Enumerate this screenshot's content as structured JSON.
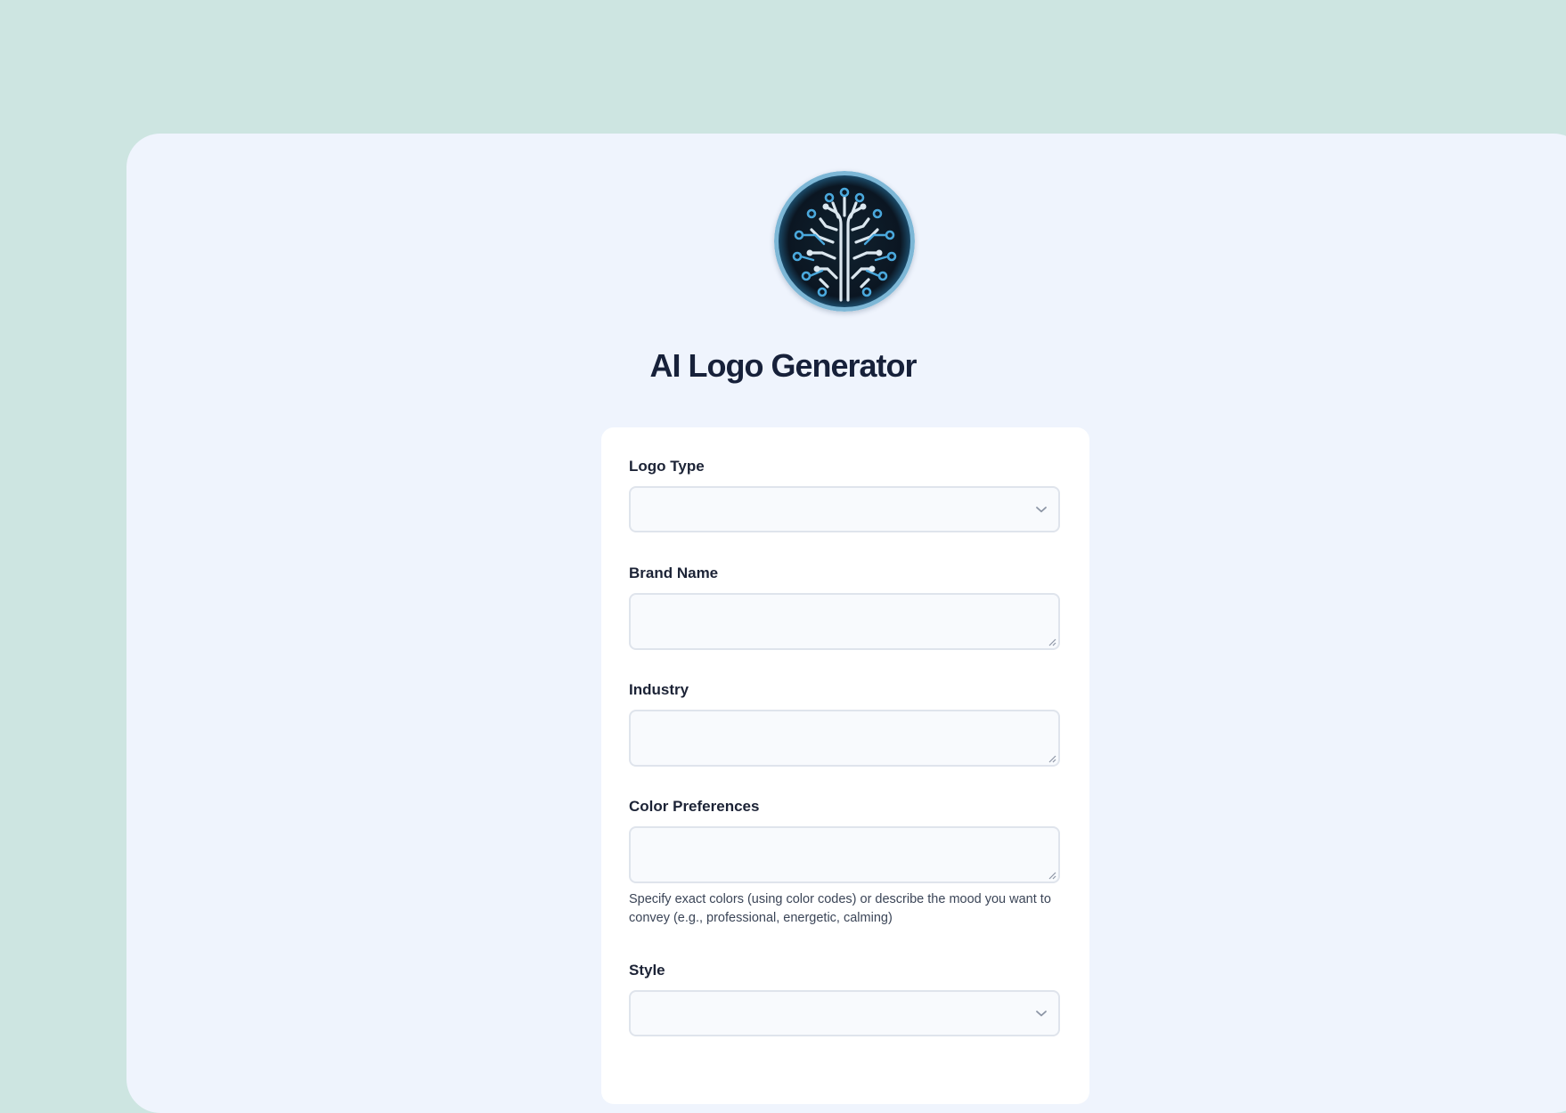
{
  "app": {
    "title": "AI Logo Generator"
  },
  "form": {
    "logo_type": {
      "label": "Logo Type",
      "value": ""
    },
    "brand_name": {
      "label": "Brand Name",
      "value": ""
    },
    "industry": {
      "label": "Industry",
      "value": ""
    },
    "color_preferences": {
      "label": "Color Preferences",
      "value": "",
      "help": "Specify exact colors (using color codes) or describe the mood you want to convey (e.g., professional, energetic, calming)"
    },
    "style": {
      "label": "Style",
      "value": ""
    }
  },
  "icons": {
    "logo": "circuit-brain-icon",
    "select_arrow": "chevron-down-icon",
    "resize": "resize-handle-icon"
  },
  "colors": {
    "page_background": "#cde5e1",
    "panel_background": "#eff4fd",
    "card_background": "#ffffff",
    "title": "#17213a",
    "logo_dark": "#0b1622",
    "logo_accent": "#4aa8dc"
  }
}
